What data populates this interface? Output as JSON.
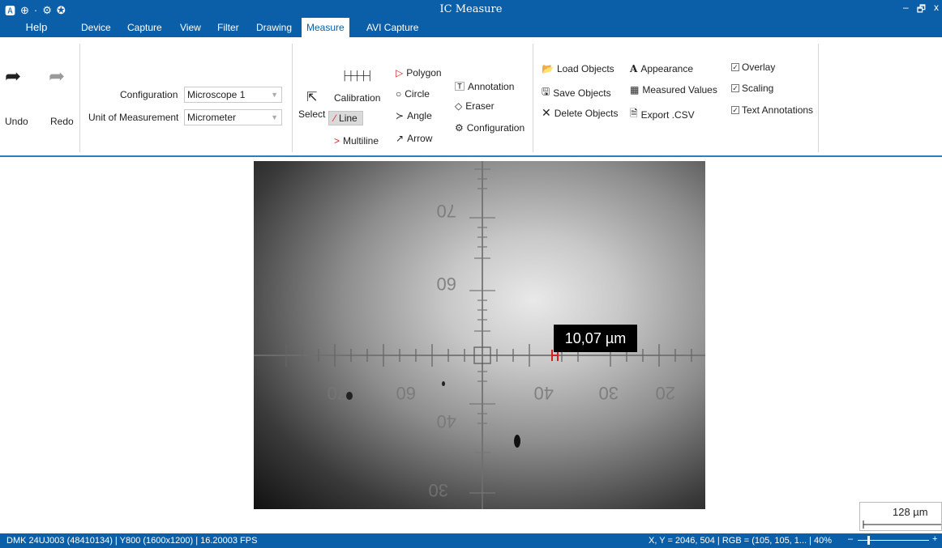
{
  "window": {
    "title": "IC Measure",
    "min": "–",
    "restore": "🗗",
    "close": "x"
  },
  "tabs": {
    "help": "Help",
    "items": [
      "Device",
      "Capture",
      "View",
      "Filter",
      "Drawing"
    ],
    "active": "Measure",
    "after": "AVI Capture"
  },
  "ribbon": {
    "undo": "Undo",
    "redo": "Redo",
    "configuration_label": "Configuration",
    "configuration_value": "Microscope 1",
    "unit_label": "Unit of Measurement",
    "unit_value": "Micrometer",
    "select": "Select",
    "calibration": "Calibration",
    "line": "Line",
    "multiline": "Multiline",
    "polygon": "Polygon",
    "circle": "Circle",
    "angle": "Angle",
    "arrow": "Arrow",
    "annotation": "Annotation",
    "eraser": "Eraser",
    "configuration": "Configuration",
    "load_objects": "Load Objects",
    "save_objects": "Save Objects",
    "delete_objects": "Delete Objects",
    "appearance": "Appearance",
    "measured_values": "Measured Values",
    "export_csv": "Export .CSV",
    "overlay": "Overlay",
    "scaling": "Scaling",
    "text_annotations": "Text Annotations"
  },
  "image": {
    "measurement": "10,07 µm",
    "scale_bar": "128 µm",
    "reticle_numbers": [
      "70",
      "60",
      "40",
      "30",
      "20",
      "60",
      "40",
      "30",
      "70"
    ]
  },
  "status": {
    "left": "DMK 24UJ003 (48410134) | Y800 (1600x1200) | 16.20003 FPS",
    "right": "X, Y = 2046, 504 | RGB = (105, 105, 1... | 40%",
    "zoom_minus": "–",
    "zoom_plus": "+"
  },
  "colors": {
    "accent": "#0a5fa8",
    "measurement_line": "#d62020"
  }
}
